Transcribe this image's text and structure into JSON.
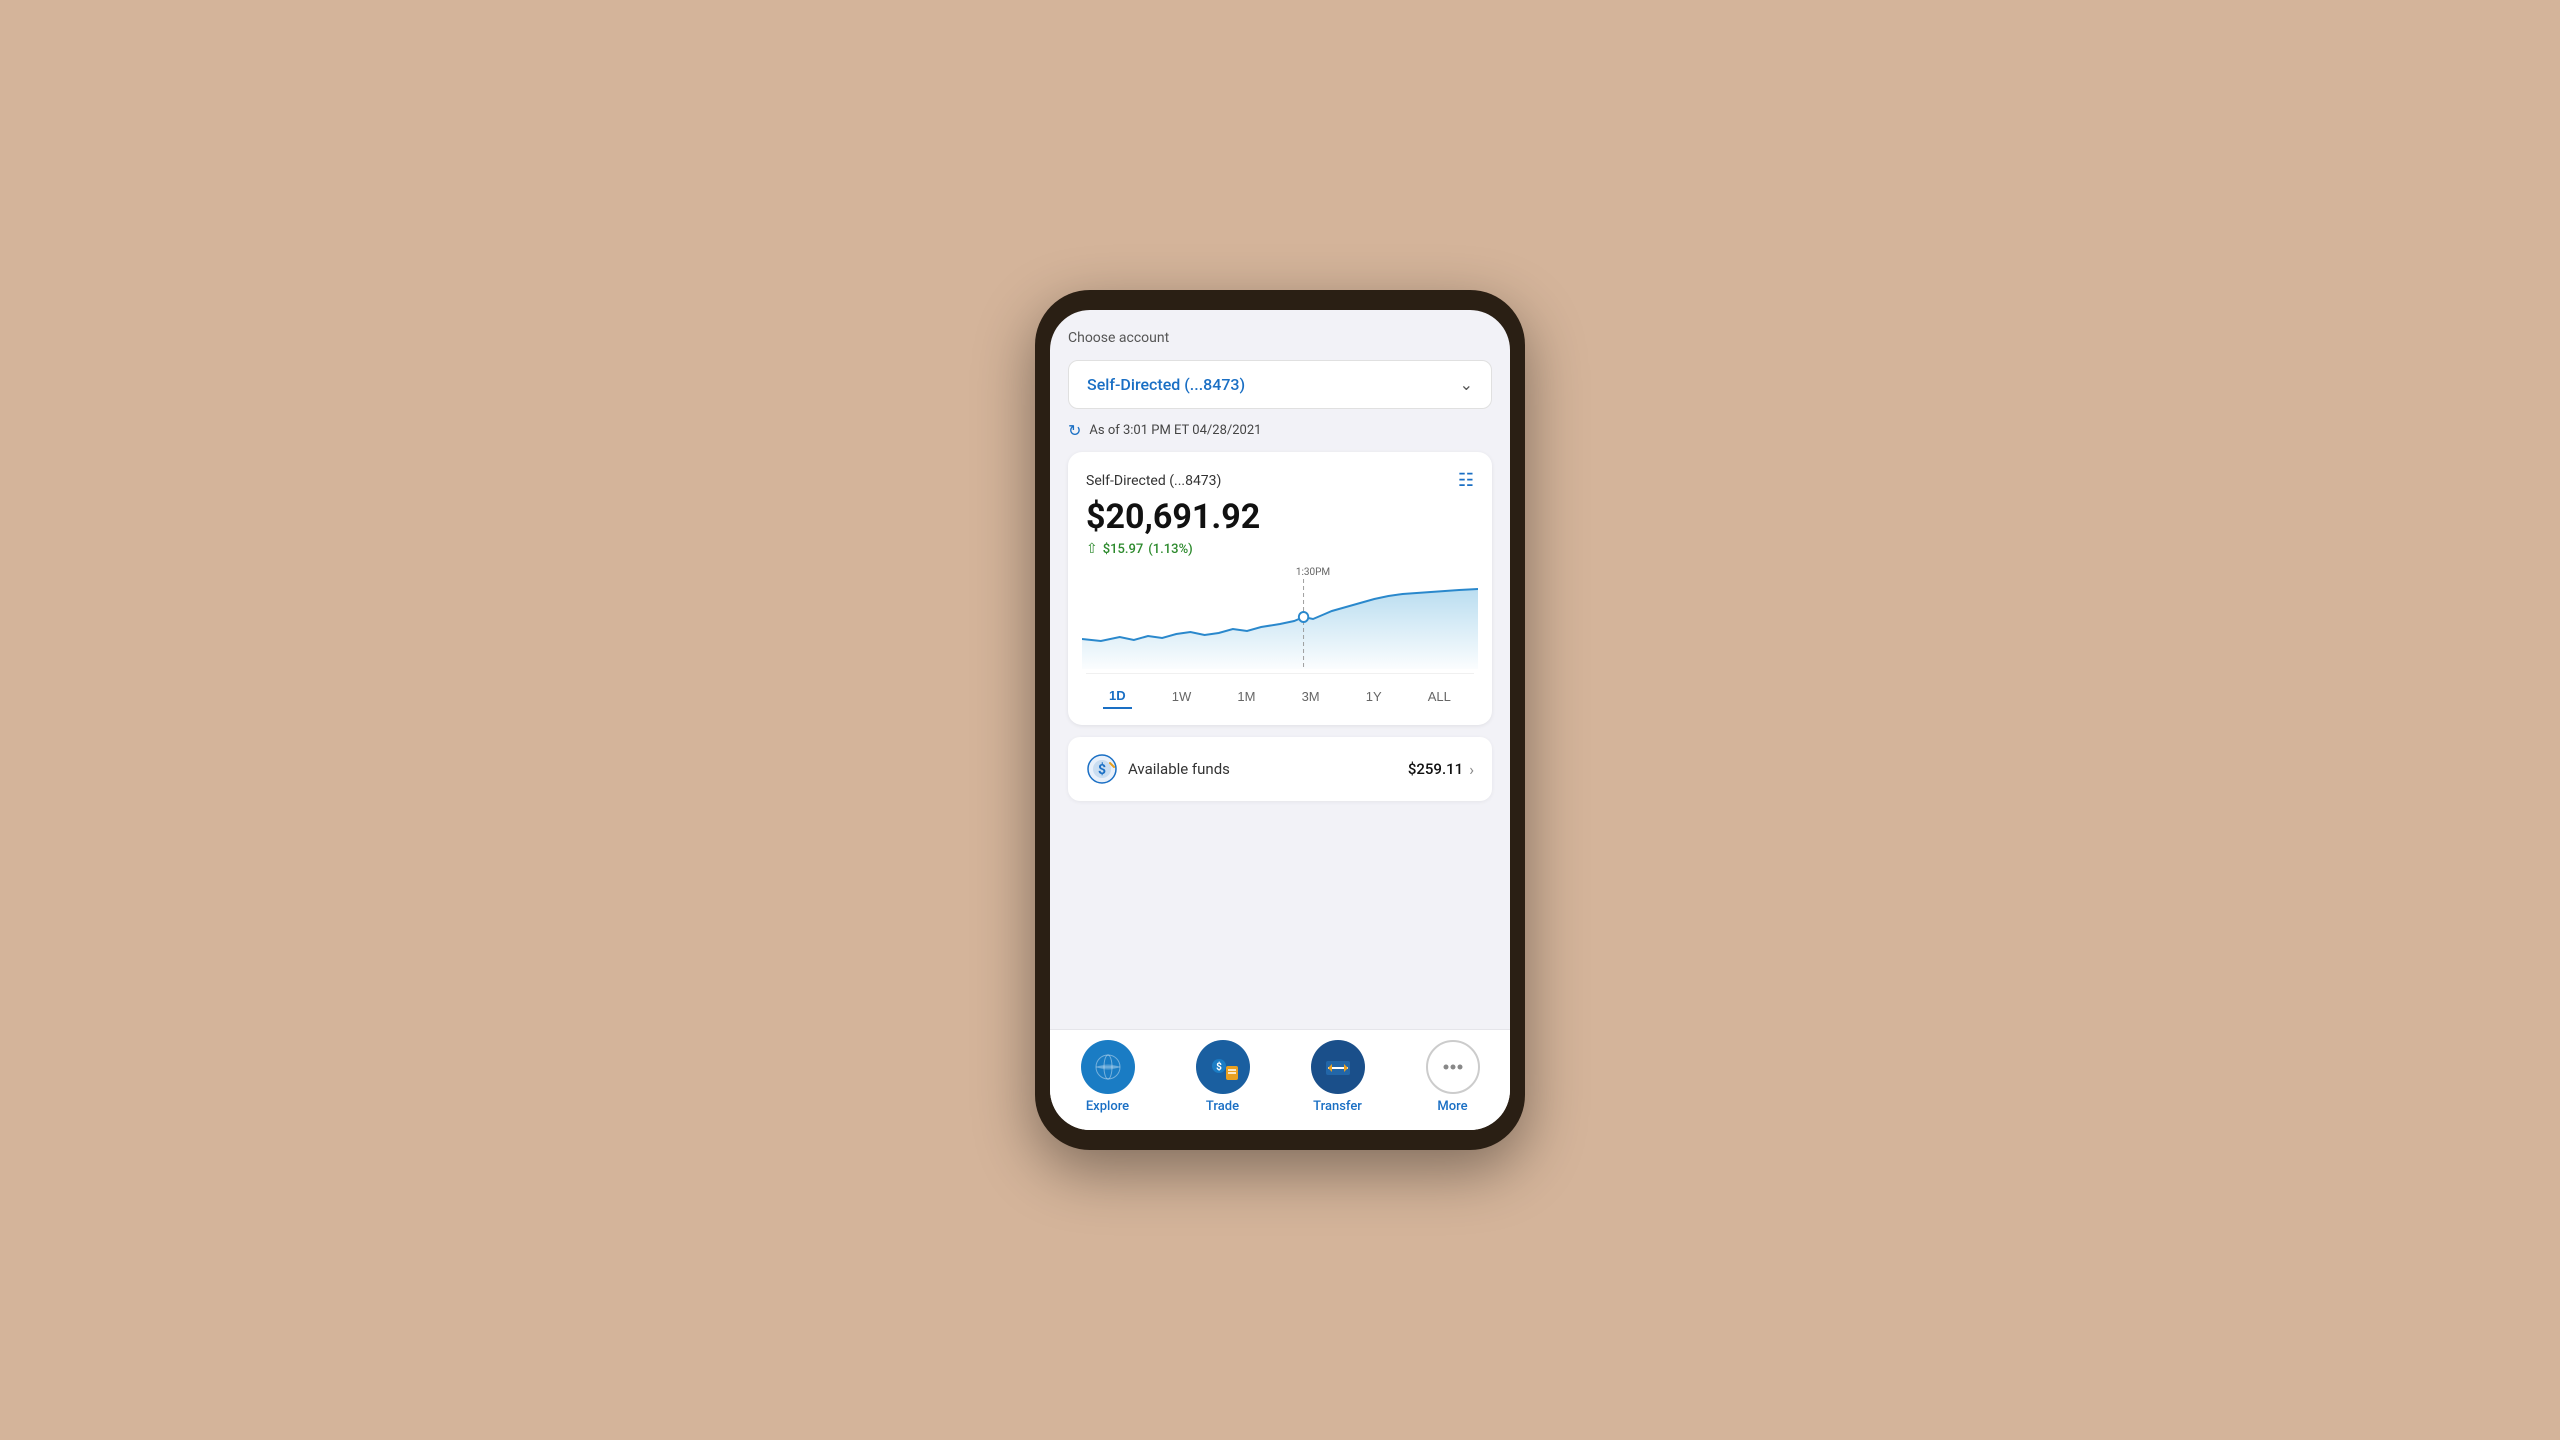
{
  "page": {
    "background_color": "#d4b49a"
  },
  "header": {
    "choose_account_label": "Choose account",
    "account_selector_text": "Self-Directed (...8473)"
  },
  "timestamp": {
    "text": "As of 3:01 PM ET 04/28/2021"
  },
  "account_card": {
    "account_name": "Self-Directed (...8473)",
    "balance": "$20,691.92",
    "change_amount": "$15.97",
    "change_percent": "(1.13%)",
    "chart_time_label": "1:30PM",
    "time_periods": [
      "1D",
      "1W",
      "1M",
      "3M",
      "1Y",
      "ALL"
    ],
    "active_period": "1D"
  },
  "available_funds": {
    "label": "Available funds",
    "amount": "$259.11"
  },
  "nav": {
    "items": [
      {
        "id": "explore",
        "label": "Explore"
      },
      {
        "id": "trade",
        "label": "Trade"
      },
      {
        "id": "transfer",
        "label": "Transfer"
      },
      {
        "id": "more",
        "label": "More"
      }
    ]
  }
}
